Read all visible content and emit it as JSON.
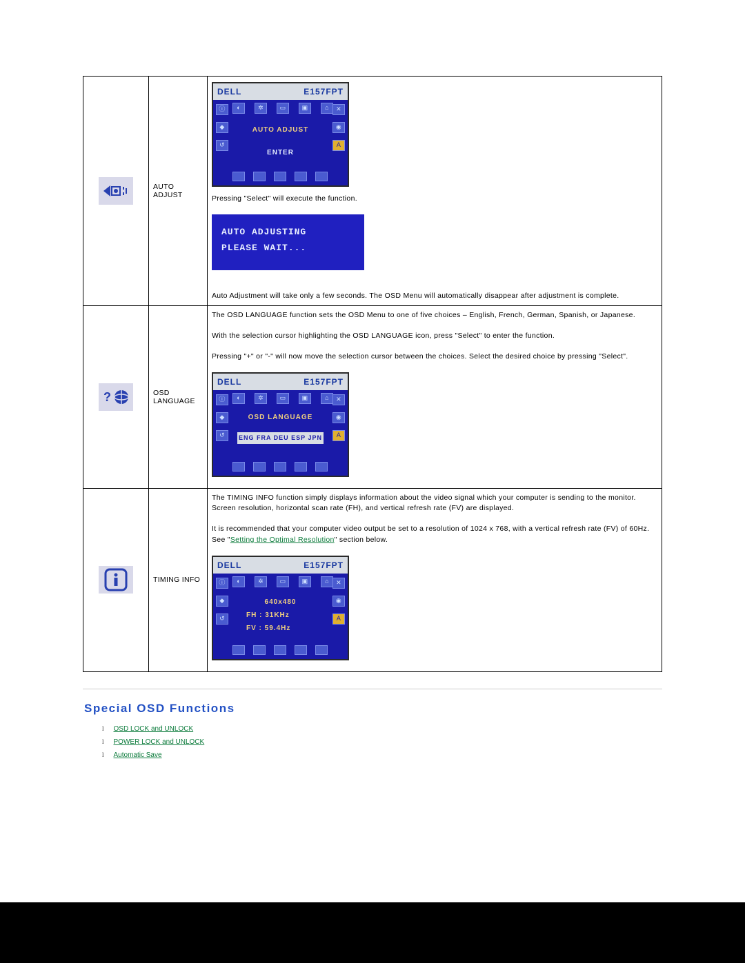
{
  "brand": "DELL",
  "model": "E157FPT",
  "rows": {
    "auto_adjust": {
      "label": "AUTO ADJUST",
      "osd": {
        "center_line1": "AUTO ADJUST",
        "center_line2": "ENTER"
      },
      "p1": "Pressing \"Select\" will execute the function.",
      "bluebox_line1": "AUTO ADJUSTING",
      "bluebox_line2": "PLEASE WAIT...",
      "p2": "Auto Adjustment will take only a few seconds. The OSD Menu will automatically disappear after adjustment is complete."
    },
    "osd_language": {
      "label": "OSD LANGUAGE",
      "p1": "The OSD LANGUAGE function sets the OSD Menu to one of five choices – English, French, German, Spanish, or Japanese.",
      "p2": "With the selection cursor highlighting the OSD LANGUAGE icon, press \"Select\" to enter the function.",
      "p3": "Pressing \"+\" or \"-\" will now move the selection cursor between the choices. Select the desired choice by pressing \"Select\".",
      "osd": {
        "center_line1": "OSD LANGUAGE",
        "options": "ENG  FRA  DEU  ESP  JPN"
      }
    },
    "timing_info": {
      "label": "TIMING INFO",
      "p1": "The TIMING INFO function simply displays information about the video signal which your computer is sending to the monitor. Screen resolution, horizontal scan rate (FH), and vertical refresh rate (FV) are displayed.",
      "p2_pre": "It is recommended that your computer video output be set to a resolution of 1024 x 768, with a vertical refresh rate (FV) of 60Hz. See \"",
      "p2_link": "Setting the Optimal Resolution",
      "p2_post": "\" section below.",
      "osd": {
        "resolution": "640x480",
        "fh": "FH  :  31KHz",
        "fv": "FV  :  59.4Hz"
      }
    }
  },
  "special": {
    "heading": "Special OSD Functions",
    "links": [
      "OSD LOCK and UNLOCK",
      "POWER LOCK and UNLOCK",
      "Automatic Save"
    ]
  }
}
